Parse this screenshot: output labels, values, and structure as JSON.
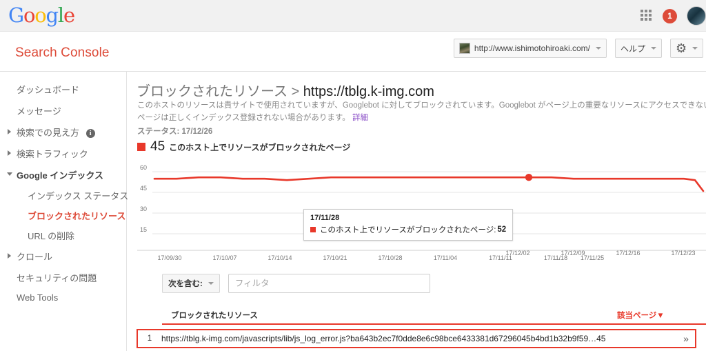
{
  "topbar": {
    "logo_text": "Google",
    "logo_letters": [
      "G",
      "o",
      "o",
      "g",
      "l",
      "e"
    ],
    "apps_icon": "apps-grid-icon",
    "notification_count": "1",
    "avatar": "user-avatar"
  },
  "header": {
    "product_title": "Search Console",
    "site_selector": "http://www.ishimotohiroaki.com/",
    "help_label": "ヘルプ",
    "settings_icon": "gear-icon"
  },
  "sidebar": {
    "items": [
      {
        "label": "ダッシュボード",
        "type": "plain"
      },
      {
        "label": "メッセージ",
        "type": "plain"
      },
      {
        "label": "検索での見え方",
        "type": "collapsed",
        "info": "i"
      },
      {
        "label": "検索トラフィック",
        "type": "collapsed"
      },
      {
        "label": "Google インデックス",
        "type": "expanded"
      },
      {
        "label": "インデックス ステータス",
        "type": "sub"
      },
      {
        "label": "ブロックされたリソース",
        "type": "sub-active"
      },
      {
        "label": "URL の削除",
        "type": "sub"
      },
      {
        "label": "クロール",
        "type": "collapsed"
      },
      {
        "label": "セキュリティの問題",
        "type": "plain"
      },
      {
        "label": "Web Tools",
        "type": "plain"
      }
    ]
  },
  "main": {
    "title_prefix": "ブロックされたリソース > ",
    "title_host": "https://tblg.k-img.com",
    "description": "このホストのリソースは貴サイトで使用されていますが、Googlebot に対してブロックされています。Googlebot がページ上の重要なリソースにアクセスできないと、そのページは正しくインデックス登録されない場合があります。 ",
    "description_link": "詳細",
    "status_label": "ステータス: 17/12/26",
    "legend_value": "45",
    "legend_label": "このホスト上でリソースがブロックされたページ",
    "legend_color": "#e8382a"
  },
  "tooltip": {
    "date": "17/11/28",
    "series_label": "このホスト上でリソースがブロックされたページ: ",
    "value": "52",
    "marker_color": "#e8382a"
  },
  "filter": {
    "operator_label": "次を含む:",
    "input_value": "",
    "input_placeholder": "フィルタ"
  },
  "table": {
    "col_resource": "ブロックされたリソース",
    "col_pages": "該当ページ▼",
    "rows": [
      {
        "index": "1",
        "url": "https://tblg.k-img.com/javascripts/lib/js_log_error.js?ba643b2ec7f0dde8e6c98bce6433381d67296045b4bd1b32b9f59…45",
        "chevron": "double-chevron-right-icon"
      }
    ]
  },
  "chart_data": {
    "type": "line",
    "title": "",
    "xlabel": "",
    "ylabel": "",
    "ylim": [
      0,
      67.5
    ],
    "yticks": [
      15,
      30,
      45,
      60
    ],
    "grid": true,
    "legend_position": "above-chart",
    "line_color": "#e8382a",
    "highlight_point": {
      "x": "17/11/28",
      "y": 52
    },
    "xticks": [
      "17/09/30",
      "17/10/07",
      "17/10/14",
      "17/10/21",
      "17/10/28",
      "17/11/04",
      "17/11/11",
      "17/11/18",
      "17/11/25",
      "17/12/02",
      "17/12/09",
      "17/12/16",
      "17/12/23"
    ],
    "series": [
      {
        "name": "このホスト上でリソースがブロックされたページ",
        "x": [
          "17/09/30",
          "17/10/02",
          "17/10/04",
          "17/10/07",
          "17/10/09",
          "17/10/11",
          "17/10/14",
          "17/10/17",
          "17/10/21",
          "17/10/28",
          "17/11/04",
          "17/11/11",
          "17/11/18",
          "17/11/25",
          "17/11/28",
          "17/12/02",
          "17/12/09",
          "17/12/16",
          "17/12/19",
          "17/12/23",
          "17/12/26"
        ],
        "values": [
          52,
          52,
          53,
          53,
          52,
          52,
          51,
          52,
          53,
          53,
          53,
          53,
          53,
          53,
          52,
          52,
          52,
          52,
          51,
          48,
          45
        ]
      }
    ]
  }
}
